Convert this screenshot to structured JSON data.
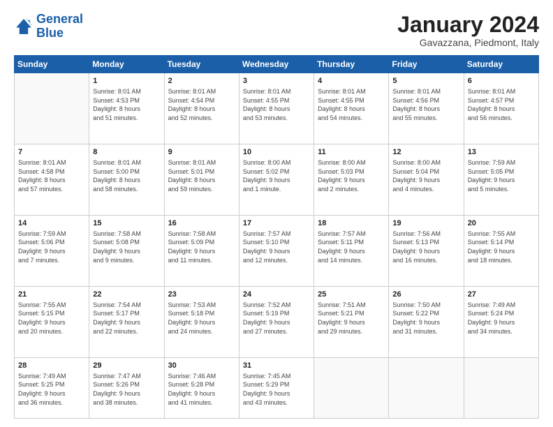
{
  "header": {
    "logo_text_general": "General",
    "logo_text_blue": "Blue",
    "month_title": "January 2024",
    "location": "Gavazzana, Piedmont, Italy"
  },
  "weekdays": [
    "Sunday",
    "Monday",
    "Tuesday",
    "Wednesday",
    "Thursday",
    "Friday",
    "Saturday"
  ],
  "weeks": [
    [
      {
        "day": "",
        "info": ""
      },
      {
        "day": "1",
        "info": "Sunrise: 8:01 AM\nSunset: 4:53 PM\nDaylight: 8 hours\nand 51 minutes."
      },
      {
        "day": "2",
        "info": "Sunrise: 8:01 AM\nSunset: 4:54 PM\nDaylight: 8 hours\nand 52 minutes."
      },
      {
        "day": "3",
        "info": "Sunrise: 8:01 AM\nSunset: 4:55 PM\nDaylight: 8 hours\nand 53 minutes."
      },
      {
        "day": "4",
        "info": "Sunrise: 8:01 AM\nSunset: 4:55 PM\nDaylight: 8 hours\nand 54 minutes."
      },
      {
        "day": "5",
        "info": "Sunrise: 8:01 AM\nSunset: 4:56 PM\nDaylight: 8 hours\nand 55 minutes."
      },
      {
        "day": "6",
        "info": "Sunrise: 8:01 AM\nSunset: 4:57 PM\nDaylight: 8 hours\nand 56 minutes."
      }
    ],
    [
      {
        "day": "7",
        "info": "Sunrise: 8:01 AM\nSunset: 4:58 PM\nDaylight: 8 hours\nand 57 minutes."
      },
      {
        "day": "8",
        "info": "Sunrise: 8:01 AM\nSunset: 5:00 PM\nDaylight: 8 hours\nand 58 minutes."
      },
      {
        "day": "9",
        "info": "Sunrise: 8:01 AM\nSunset: 5:01 PM\nDaylight: 8 hours\nand 59 minutes."
      },
      {
        "day": "10",
        "info": "Sunrise: 8:00 AM\nSunset: 5:02 PM\nDaylight: 9 hours\nand 1 minute."
      },
      {
        "day": "11",
        "info": "Sunrise: 8:00 AM\nSunset: 5:03 PM\nDaylight: 9 hours\nand 2 minutes."
      },
      {
        "day": "12",
        "info": "Sunrise: 8:00 AM\nSunset: 5:04 PM\nDaylight: 9 hours\nand 4 minutes."
      },
      {
        "day": "13",
        "info": "Sunrise: 7:59 AM\nSunset: 5:05 PM\nDaylight: 9 hours\nand 5 minutes."
      }
    ],
    [
      {
        "day": "14",
        "info": "Sunrise: 7:59 AM\nSunset: 5:06 PM\nDaylight: 9 hours\nand 7 minutes."
      },
      {
        "day": "15",
        "info": "Sunrise: 7:58 AM\nSunset: 5:08 PM\nDaylight: 9 hours\nand 9 minutes."
      },
      {
        "day": "16",
        "info": "Sunrise: 7:58 AM\nSunset: 5:09 PM\nDaylight: 9 hours\nand 11 minutes."
      },
      {
        "day": "17",
        "info": "Sunrise: 7:57 AM\nSunset: 5:10 PM\nDaylight: 9 hours\nand 12 minutes."
      },
      {
        "day": "18",
        "info": "Sunrise: 7:57 AM\nSunset: 5:11 PM\nDaylight: 9 hours\nand 14 minutes."
      },
      {
        "day": "19",
        "info": "Sunrise: 7:56 AM\nSunset: 5:13 PM\nDaylight: 9 hours\nand 16 minutes."
      },
      {
        "day": "20",
        "info": "Sunrise: 7:55 AM\nSunset: 5:14 PM\nDaylight: 9 hours\nand 18 minutes."
      }
    ],
    [
      {
        "day": "21",
        "info": "Sunrise: 7:55 AM\nSunset: 5:15 PM\nDaylight: 9 hours\nand 20 minutes."
      },
      {
        "day": "22",
        "info": "Sunrise: 7:54 AM\nSunset: 5:17 PM\nDaylight: 9 hours\nand 22 minutes."
      },
      {
        "day": "23",
        "info": "Sunrise: 7:53 AM\nSunset: 5:18 PM\nDaylight: 9 hours\nand 24 minutes."
      },
      {
        "day": "24",
        "info": "Sunrise: 7:52 AM\nSunset: 5:19 PM\nDaylight: 9 hours\nand 27 minutes."
      },
      {
        "day": "25",
        "info": "Sunrise: 7:51 AM\nSunset: 5:21 PM\nDaylight: 9 hours\nand 29 minutes."
      },
      {
        "day": "26",
        "info": "Sunrise: 7:50 AM\nSunset: 5:22 PM\nDaylight: 9 hours\nand 31 minutes."
      },
      {
        "day": "27",
        "info": "Sunrise: 7:49 AM\nSunset: 5:24 PM\nDaylight: 9 hours\nand 34 minutes."
      }
    ],
    [
      {
        "day": "28",
        "info": "Sunrise: 7:49 AM\nSunset: 5:25 PM\nDaylight: 9 hours\nand 36 minutes."
      },
      {
        "day": "29",
        "info": "Sunrise: 7:47 AM\nSunset: 5:26 PM\nDaylight: 9 hours\nand 38 minutes."
      },
      {
        "day": "30",
        "info": "Sunrise: 7:46 AM\nSunset: 5:28 PM\nDaylight: 9 hours\nand 41 minutes."
      },
      {
        "day": "31",
        "info": "Sunrise: 7:45 AM\nSunset: 5:29 PM\nDaylight: 9 hours\nand 43 minutes."
      },
      {
        "day": "",
        "info": ""
      },
      {
        "day": "",
        "info": ""
      },
      {
        "day": "",
        "info": ""
      }
    ]
  ]
}
